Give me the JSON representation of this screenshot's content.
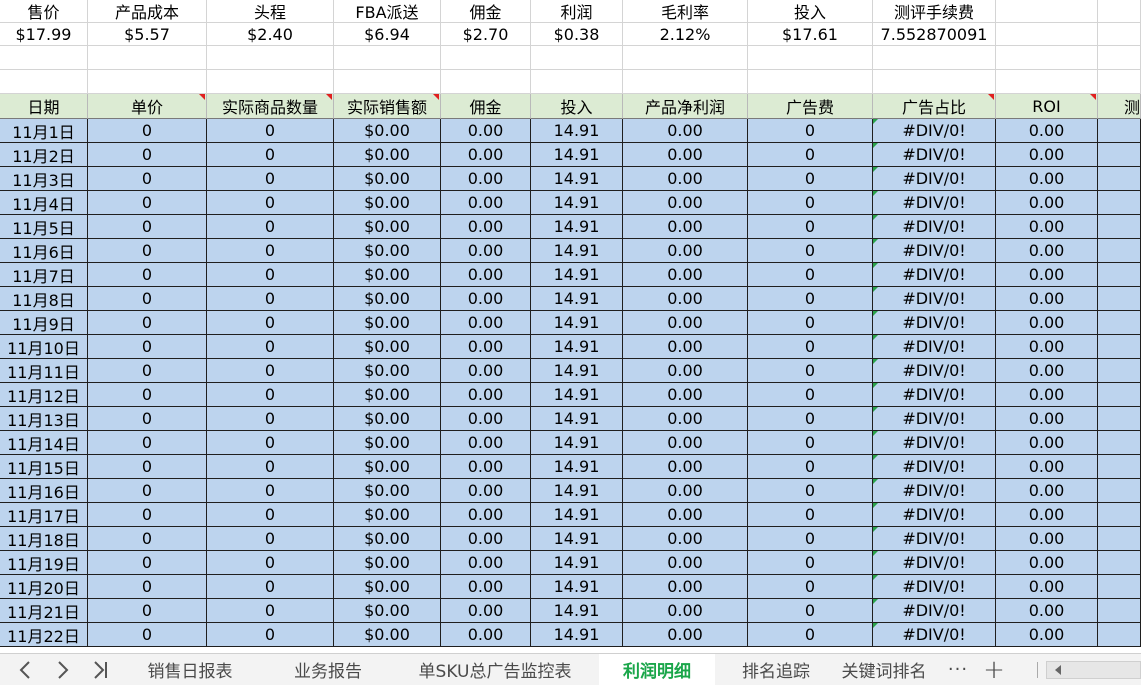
{
  "summary": {
    "headers": [
      "售价",
      "产品成本",
      "头程",
      "FBA派送",
      "佣金",
      "利润",
      "毛利率",
      "投入",
      "测评手续费"
    ],
    "values": [
      "$17.99",
      "$5.57",
      "$2.40",
      "$6.94",
      "$2.70",
      "$0.38",
      "2.12%",
      "$17.61",
      "7.552870091"
    ]
  },
  "table": {
    "headers": [
      "日期",
      "单价",
      "实际商品数量",
      "实际销售额",
      "佣金",
      "投入",
      "产品净利润",
      "广告费",
      "广告占比",
      "ROI",
      "测"
    ],
    "rows": [
      [
        "11月1日",
        "0",
        "0",
        "$0.00",
        "0.00",
        "14.91",
        "0.00",
        "0",
        "#DIV/0!",
        "0.00"
      ],
      [
        "11月2日",
        "0",
        "0",
        "$0.00",
        "0.00",
        "14.91",
        "0.00",
        "0",
        "#DIV/0!",
        "0.00"
      ],
      [
        "11月3日",
        "0",
        "0",
        "$0.00",
        "0.00",
        "14.91",
        "0.00",
        "0",
        "#DIV/0!",
        "0.00"
      ],
      [
        "11月4日",
        "0",
        "0",
        "$0.00",
        "0.00",
        "14.91",
        "0.00",
        "0",
        "#DIV/0!",
        "0.00"
      ],
      [
        "11月5日",
        "0",
        "0",
        "$0.00",
        "0.00",
        "14.91",
        "0.00",
        "0",
        "#DIV/0!",
        "0.00"
      ],
      [
        "11月6日",
        "0",
        "0",
        "$0.00",
        "0.00",
        "14.91",
        "0.00",
        "0",
        "#DIV/0!",
        "0.00"
      ],
      [
        "11月7日",
        "0",
        "0",
        "$0.00",
        "0.00",
        "14.91",
        "0.00",
        "0",
        "#DIV/0!",
        "0.00"
      ],
      [
        "11月8日",
        "0",
        "0",
        "$0.00",
        "0.00",
        "14.91",
        "0.00",
        "0",
        "#DIV/0!",
        "0.00"
      ],
      [
        "11月9日",
        "0",
        "0",
        "$0.00",
        "0.00",
        "14.91",
        "0.00",
        "0",
        "#DIV/0!",
        "0.00"
      ],
      [
        "11月10日",
        "0",
        "0",
        "$0.00",
        "0.00",
        "14.91",
        "0.00",
        "0",
        "#DIV/0!",
        "0.00"
      ],
      [
        "11月11日",
        "0",
        "0",
        "$0.00",
        "0.00",
        "14.91",
        "0.00",
        "0",
        "#DIV/0!",
        "0.00"
      ],
      [
        "11月12日",
        "0",
        "0",
        "$0.00",
        "0.00",
        "14.91",
        "0.00",
        "0",
        "#DIV/0!",
        "0.00"
      ],
      [
        "11月13日",
        "0",
        "0",
        "$0.00",
        "0.00",
        "14.91",
        "0.00",
        "0",
        "#DIV/0!",
        "0.00"
      ],
      [
        "11月14日",
        "0",
        "0",
        "$0.00",
        "0.00",
        "14.91",
        "0.00",
        "0",
        "#DIV/0!",
        "0.00"
      ],
      [
        "11月15日",
        "0",
        "0",
        "$0.00",
        "0.00",
        "14.91",
        "0.00",
        "0",
        "#DIV/0!",
        "0.00"
      ],
      [
        "11月16日",
        "0",
        "0",
        "$0.00",
        "0.00",
        "14.91",
        "0.00",
        "0",
        "#DIV/0!",
        "0.00"
      ],
      [
        "11月17日",
        "0",
        "0",
        "$0.00",
        "0.00",
        "14.91",
        "0.00",
        "0",
        "#DIV/0!",
        "0.00"
      ],
      [
        "11月18日",
        "0",
        "0",
        "$0.00",
        "0.00",
        "14.91",
        "0.00",
        "0",
        "#DIV/0!",
        "0.00"
      ],
      [
        "11月19日",
        "0",
        "0",
        "$0.00",
        "0.00",
        "14.91",
        "0.00",
        "0",
        "#DIV/0!",
        "0.00"
      ],
      [
        "11月20日",
        "0",
        "0",
        "$0.00",
        "0.00",
        "14.91",
        "0.00",
        "0",
        "#DIV/0!",
        "0.00"
      ],
      [
        "11月21日",
        "0",
        "0",
        "$0.00",
        "0.00",
        "14.91",
        "0.00",
        "0",
        "#DIV/0!",
        "0.00"
      ],
      [
        "11月22日",
        "0",
        "0",
        "$0.00",
        "0.00",
        "14.91",
        "0.00",
        "0",
        "#DIV/0!",
        "0.00"
      ]
    ]
  },
  "tabs": {
    "sheets": [
      "销售日报表",
      "业务报告",
      "单SKU总广告监控表",
      "利润明细",
      "排名追踪",
      "关键词排名"
    ],
    "active": "利润明细",
    "more_label": "···",
    "add_label": "+"
  },
  "colors": {
    "header_green": "#dcebd3",
    "data_blue": "#bdd4ee",
    "active_tab_text": "#1aa64a",
    "comment_marker": "#e02020",
    "error_marker": "#2aa24a"
  }
}
